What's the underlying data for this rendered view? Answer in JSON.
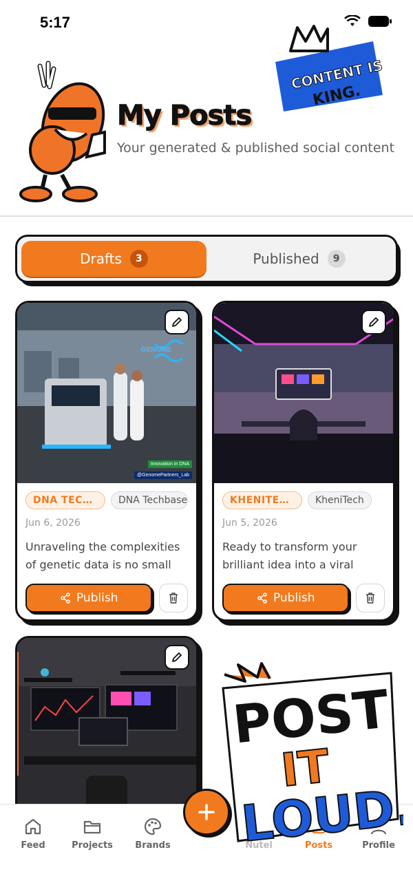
{
  "status_bar": {
    "time": "5:17"
  },
  "header": {
    "title": "My Posts",
    "subtitle": "Your generated & published social content",
    "badge_text": [
      "CONTENT IS",
      "KING."
    ]
  },
  "tabs": [
    {
      "label": "Drafts",
      "count": "3",
      "active": true
    },
    {
      "label": "Published",
      "count": "9",
      "active": false
    }
  ],
  "posts": [
    {
      "brand_chip": "DNA TECH ...",
      "name_chip": "DNA Techbase",
      "date": "Jun 6, 2026",
      "text": "Unraveling the complexities of genetic data is no small feat,...",
      "publish_label": "Publish",
      "image_overlay": {
        "logo": "GENOME",
        "badge1": "Innovation in DNA",
        "badge2": "@GenomePartners_Lab"
      }
    },
    {
      "brand_chip": "KHENITECH",
      "name_chip": "KheniTech",
      "date": "Jun 5, 2026",
      "text": "Ready to transform your brilliant idea into a viral app?...",
      "publish_label": "Publish"
    }
  ],
  "sticker_text": [
    "POST",
    "IT",
    "LOUD."
  ],
  "bottom_nav": [
    {
      "label": "Feed",
      "icon": "home-icon",
      "active": false
    },
    {
      "label": "Projects",
      "icon": "folder-icon",
      "active": false
    },
    {
      "label": "Brands",
      "icon": "palette-icon",
      "active": false
    },
    {
      "label": "Nutel",
      "icon": "user-icon",
      "active": false
    },
    {
      "label": "Posts",
      "icon": "posts-icon",
      "active": true
    },
    {
      "label": "Profile",
      "icon": "profile-icon",
      "active": false
    }
  ],
  "colors": {
    "accent": "#f27a1e",
    "accent_dark": "#c4540c",
    "outline": "#111111",
    "badge_blue": "#1e5bd8"
  }
}
